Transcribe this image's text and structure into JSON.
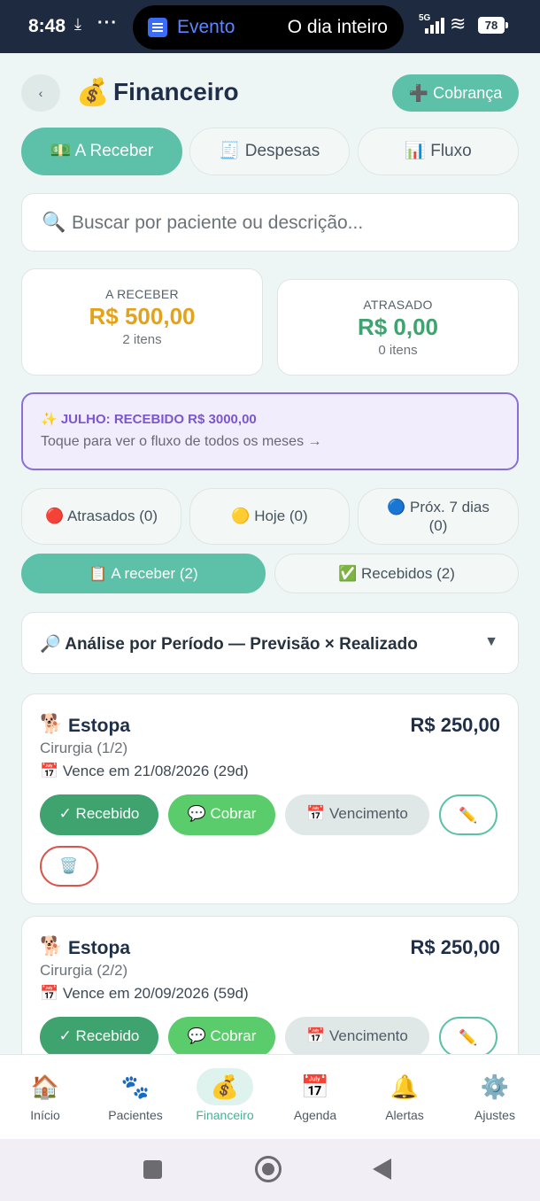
{
  "status_bar": {
    "time": "8:48",
    "download_icon": "download-icon",
    "more": "···",
    "event_label": "Evento",
    "event_time": "O dia inteiro",
    "network": "5G",
    "battery": "78"
  },
  "header": {
    "back_icon": "‹",
    "title_icon": "💰",
    "title": "Financeiro",
    "new_charge_label": "➕ Cobrança"
  },
  "tabs": [
    {
      "label": "💵 A Receber",
      "active": true
    },
    {
      "label": "🧾 Despesas",
      "active": false
    },
    {
      "label": "📊 Fluxo",
      "active": false
    }
  ],
  "search": {
    "icon": "🔍",
    "placeholder": "Buscar por paciente ou descrição..."
  },
  "summary": {
    "receivable": {
      "label": "A RECEBER",
      "value": "R$ 500,00",
      "sub": "2 itens",
      "color": "#e3a21a"
    },
    "overdue": {
      "label": "ATRASADO",
      "value": "R$ 0,00",
      "sub": "0 itens",
      "color": "#3fa36f"
    }
  },
  "banner": {
    "title": "✨ JULHO: RECEBIDO R$ 3000,00",
    "subtitle": "Toque para ver o fluxo de todos os meses →"
  },
  "filters": {
    "overdue": "🔴 Atrasados (0)",
    "today": "🟡 Hoje (0)",
    "next7_line1": "🔵 Próx. 7 dias",
    "next7_line2": "(0)"
  },
  "lists": {
    "to_receive": "📋 A receber (2)",
    "received": "✅ Recebidos (2)"
  },
  "period": {
    "title": "🔎 Análise por Período — Previsão × Realizado",
    "chevron": "▼"
  },
  "items": [
    {
      "pet_icon": "🐕",
      "name": "Estopa",
      "amount": "R$ 250,00",
      "description": "Cirurgia (1/2)",
      "due": "📅 Vence em 21/08/2026 (29d)",
      "received_label": "✓ Recebido",
      "charge_label": "💬 Cobrar",
      "due_label": "📅 Vencimento",
      "edit_icon": "✏️",
      "delete_icon": "🗑️"
    },
    {
      "pet_icon": "🐕",
      "name": "Estopa",
      "amount": "R$ 250,00",
      "description": "Cirurgia (2/2)",
      "due": "📅 Vence em 20/09/2026 (59d)",
      "received_label": "✓ Recebido",
      "charge_label": "💬 Cobrar",
      "due_label": "📅 Vencimento",
      "edit_icon": "✏️"
    }
  ],
  "bottom_nav": [
    {
      "icon": "🏠",
      "label": "Início"
    },
    {
      "icon": "🐾",
      "label": "Pacientes"
    },
    {
      "icon": "💰",
      "label": "Financeiro",
      "active": true
    },
    {
      "icon": "📅",
      "label": "Agenda"
    },
    {
      "icon": "🔔",
      "label": "Alertas"
    },
    {
      "icon": "⚙️",
      "label": "Ajustes"
    }
  ],
  "colors": {
    "accent": "#5dc0a8",
    "status_bar": "#1e2a3f",
    "received_button": "#3fa36f",
    "charge_button": "#5bcc6c",
    "banner_border": "#8b6fd8"
  }
}
